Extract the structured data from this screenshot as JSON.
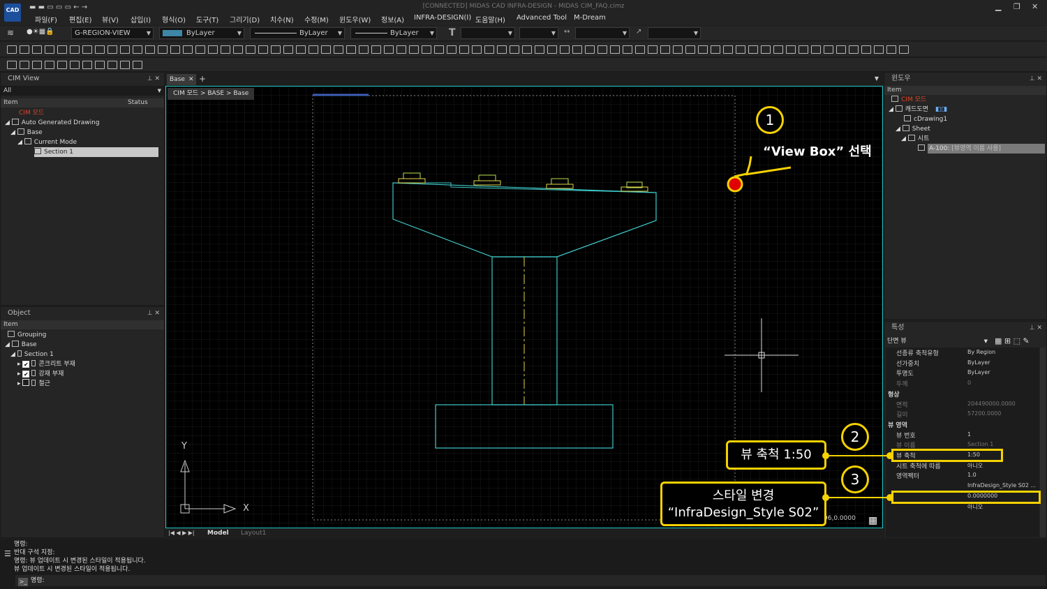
{
  "app": {
    "title": "[CONNECTED] MIDAS CAD INFRA-DESIGN - MIDAS CIM_FAQ.cimz",
    "logo": "CAD"
  },
  "menu": [
    "파일(F)",
    "편집(E)",
    "뷰(V)",
    "삽입(I)",
    "형식(O)",
    "도구(T)",
    "그리기(D)",
    "치수(N)",
    "수정(M)",
    "윈도우(W)",
    "정보(A)",
    "INFRA-DESIGN(I)",
    "도움말(H)",
    "Advanced Tool",
    "M-Dream"
  ],
  "toolbar": {
    "layer": "G-REGION-VIEW",
    "color": "ByLayer",
    "linetype": "ByLayer",
    "lineweight": "ByLayer",
    "text_style_glyph": "T"
  },
  "cim_view": {
    "title": "CIM View",
    "filter": "All",
    "col_item": "Item",
    "col_status": "Status",
    "tree": [
      {
        "label": "CIM 모드",
        "red": true
      },
      {
        "label": "Auto Generated Drawing"
      },
      {
        "label": "Base"
      },
      {
        "label": "Current Mode"
      },
      {
        "label": "Section 1"
      }
    ]
  },
  "object_panel": {
    "title": "Object",
    "col_item": "Item",
    "tree": [
      {
        "label": "Grouping"
      },
      {
        "label": "Base"
      },
      {
        "label": "Section 1"
      },
      {
        "label": "콘크리트 부재",
        "checked": true
      },
      {
        "label": "강재 부재",
        "checked": true
      },
      {
        "label": "철근",
        "checked": false
      }
    ]
  },
  "doc_tabs": {
    "active": "Base",
    "add": "+",
    "breadcrumb": "CIM 모드 > BASE > Base"
  },
  "canvas": {
    "axis_y": "Y",
    "axis_x": "X",
    "coords": "96,0.0000"
  },
  "layout_tabs": {
    "model": "Model",
    "layout": "Layout1"
  },
  "window_panel": {
    "title": "윈도우",
    "col_item": "Item",
    "tree": [
      {
        "label": "CIM 모드",
        "red": true
      },
      {
        "label": "캐드도면"
      },
      {
        "label": "cDrawing1"
      },
      {
        "label": "Sheet"
      },
      {
        "label": "시트"
      },
      {
        "label": "A-100:",
        "extra": "[뷰영역 이름 사용]"
      }
    ]
  },
  "properties": {
    "title": "특성",
    "selector": "단면 뷰",
    "rows": [
      {
        "label": "선종류 축척유형",
        "value": "By Region"
      },
      {
        "label": "선가중치",
        "value": "ByLayer"
      },
      {
        "label": "투명도",
        "value": "ByLayer"
      },
      {
        "label": "두께",
        "value": "0",
        "dim": true
      },
      {
        "label": "형상",
        "value": "",
        "section": true
      },
      {
        "label": "면적",
        "value": "204490000.0000",
        "dim": true
      },
      {
        "label": "길이",
        "value": "57200.0000",
        "dim": true
      },
      {
        "label": "뷰 영역",
        "value": "",
        "section": true
      },
      {
        "label": "뷰 번호",
        "value": "1"
      },
      {
        "label": "뷰 이름",
        "value": "Section 1",
        "dim": true
      },
      {
        "label": "뷰 축척",
        "value": "1:50"
      },
      {
        "label": "시트 축척에 따름",
        "value": "아니오"
      },
      {
        "label": "영역팩터",
        "value": "1.0"
      },
      {
        "label": "",
        "value": "InfraDesign_Style S02 ..."
      },
      {
        "label": "",
        "value": "0.0000000"
      },
      {
        "label": "",
        "value": "아니오"
      }
    ]
  },
  "command": {
    "lines": [
      "명령:",
      "반대 구석 지정:",
      "명령: 뷰 업데이트 시 변경된 스타일이 적용됩니다.",
      "뷰 업데이트 시 변경된 스타일이 적용됩니다."
    ],
    "prompt": "명령:"
  },
  "annotations": {
    "c1": "1",
    "c2": "2",
    "c3": "3",
    "viewbox": "“View Box” 선택",
    "scale": "뷰 축척 1:50",
    "style_l1": "스타일 변경",
    "style_l2": "“InfraDesign_Style S02”"
  },
  "colors": {
    "accent": "#f5d200",
    "cyan": "#1cc7c7",
    "red_label": "#e0442b",
    "marker": "#e00000"
  }
}
